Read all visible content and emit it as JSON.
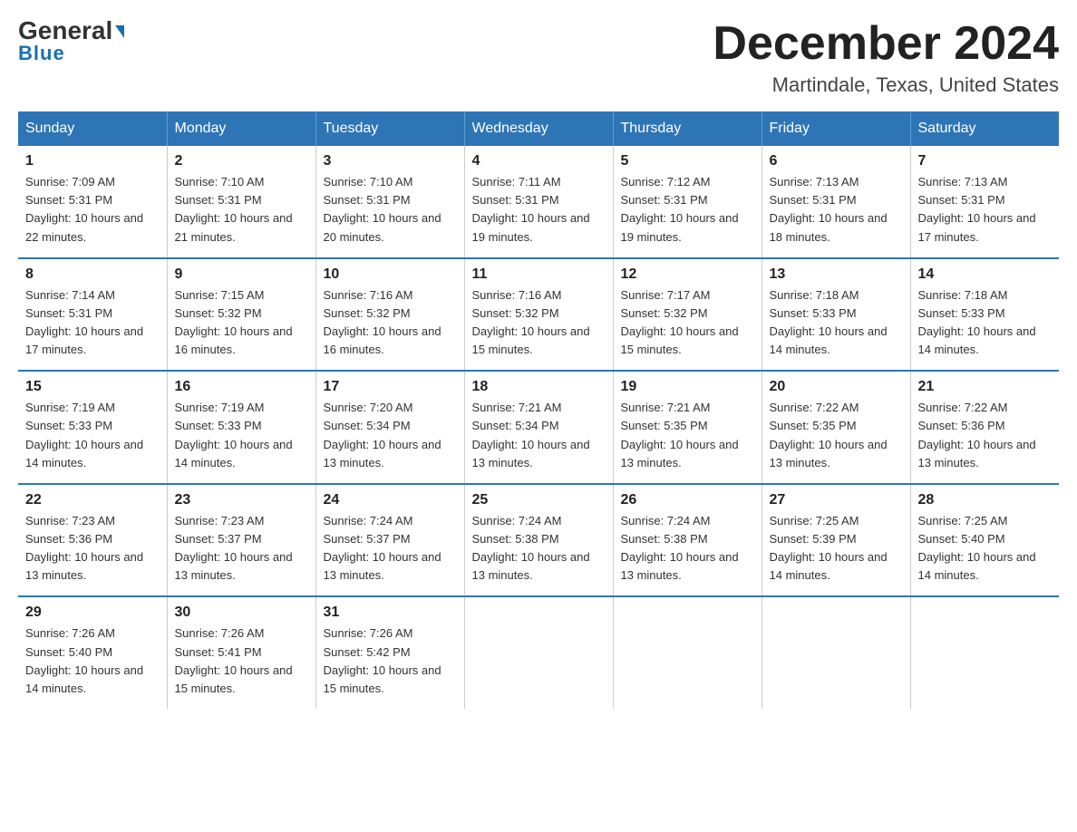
{
  "logo": {
    "general": "General",
    "triangle": "▶",
    "blue": "Blue"
  },
  "header": {
    "month": "December 2024",
    "location": "Martindale, Texas, United States"
  },
  "days_of_week": [
    "Sunday",
    "Monday",
    "Tuesday",
    "Wednesday",
    "Thursday",
    "Friday",
    "Saturday"
  ],
  "weeks": [
    [
      {
        "day": "1",
        "sunrise": "7:09 AM",
        "sunset": "5:31 PM",
        "daylight": "10 hours and 22 minutes."
      },
      {
        "day": "2",
        "sunrise": "7:10 AM",
        "sunset": "5:31 PM",
        "daylight": "10 hours and 21 minutes."
      },
      {
        "day": "3",
        "sunrise": "7:10 AM",
        "sunset": "5:31 PM",
        "daylight": "10 hours and 20 minutes."
      },
      {
        "day": "4",
        "sunrise": "7:11 AM",
        "sunset": "5:31 PM",
        "daylight": "10 hours and 19 minutes."
      },
      {
        "day": "5",
        "sunrise": "7:12 AM",
        "sunset": "5:31 PM",
        "daylight": "10 hours and 19 minutes."
      },
      {
        "day": "6",
        "sunrise": "7:13 AM",
        "sunset": "5:31 PM",
        "daylight": "10 hours and 18 minutes."
      },
      {
        "day": "7",
        "sunrise": "7:13 AM",
        "sunset": "5:31 PM",
        "daylight": "10 hours and 17 minutes."
      }
    ],
    [
      {
        "day": "8",
        "sunrise": "7:14 AM",
        "sunset": "5:31 PM",
        "daylight": "10 hours and 17 minutes."
      },
      {
        "day": "9",
        "sunrise": "7:15 AM",
        "sunset": "5:32 PM",
        "daylight": "10 hours and 16 minutes."
      },
      {
        "day": "10",
        "sunrise": "7:16 AM",
        "sunset": "5:32 PM",
        "daylight": "10 hours and 16 minutes."
      },
      {
        "day": "11",
        "sunrise": "7:16 AM",
        "sunset": "5:32 PM",
        "daylight": "10 hours and 15 minutes."
      },
      {
        "day": "12",
        "sunrise": "7:17 AM",
        "sunset": "5:32 PM",
        "daylight": "10 hours and 15 minutes."
      },
      {
        "day": "13",
        "sunrise": "7:18 AM",
        "sunset": "5:33 PM",
        "daylight": "10 hours and 14 minutes."
      },
      {
        "day": "14",
        "sunrise": "7:18 AM",
        "sunset": "5:33 PM",
        "daylight": "10 hours and 14 minutes."
      }
    ],
    [
      {
        "day": "15",
        "sunrise": "7:19 AM",
        "sunset": "5:33 PM",
        "daylight": "10 hours and 14 minutes."
      },
      {
        "day": "16",
        "sunrise": "7:19 AM",
        "sunset": "5:33 PM",
        "daylight": "10 hours and 14 minutes."
      },
      {
        "day": "17",
        "sunrise": "7:20 AM",
        "sunset": "5:34 PM",
        "daylight": "10 hours and 13 minutes."
      },
      {
        "day": "18",
        "sunrise": "7:21 AM",
        "sunset": "5:34 PM",
        "daylight": "10 hours and 13 minutes."
      },
      {
        "day": "19",
        "sunrise": "7:21 AM",
        "sunset": "5:35 PM",
        "daylight": "10 hours and 13 minutes."
      },
      {
        "day": "20",
        "sunrise": "7:22 AM",
        "sunset": "5:35 PM",
        "daylight": "10 hours and 13 minutes."
      },
      {
        "day": "21",
        "sunrise": "7:22 AM",
        "sunset": "5:36 PM",
        "daylight": "10 hours and 13 minutes."
      }
    ],
    [
      {
        "day": "22",
        "sunrise": "7:23 AM",
        "sunset": "5:36 PM",
        "daylight": "10 hours and 13 minutes."
      },
      {
        "day": "23",
        "sunrise": "7:23 AM",
        "sunset": "5:37 PM",
        "daylight": "10 hours and 13 minutes."
      },
      {
        "day": "24",
        "sunrise": "7:24 AM",
        "sunset": "5:37 PM",
        "daylight": "10 hours and 13 minutes."
      },
      {
        "day": "25",
        "sunrise": "7:24 AM",
        "sunset": "5:38 PM",
        "daylight": "10 hours and 13 minutes."
      },
      {
        "day": "26",
        "sunrise": "7:24 AM",
        "sunset": "5:38 PM",
        "daylight": "10 hours and 13 minutes."
      },
      {
        "day": "27",
        "sunrise": "7:25 AM",
        "sunset": "5:39 PM",
        "daylight": "10 hours and 14 minutes."
      },
      {
        "day": "28",
        "sunrise": "7:25 AM",
        "sunset": "5:40 PM",
        "daylight": "10 hours and 14 minutes."
      }
    ],
    [
      {
        "day": "29",
        "sunrise": "7:26 AM",
        "sunset": "5:40 PM",
        "daylight": "10 hours and 14 minutes."
      },
      {
        "day": "30",
        "sunrise": "7:26 AM",
        "sunset": "5:41 PM",
        "daylight": "10 hours and 15 minutes."
      },
      {
        "day": "31",
        "sunrise": "7:26 AM",
        "sunset": "5:42 PM",
        "daylight": "10 hours and 15 minutes."
      },
      null,
      null,
      null,
      null
    ]
  ]
}
